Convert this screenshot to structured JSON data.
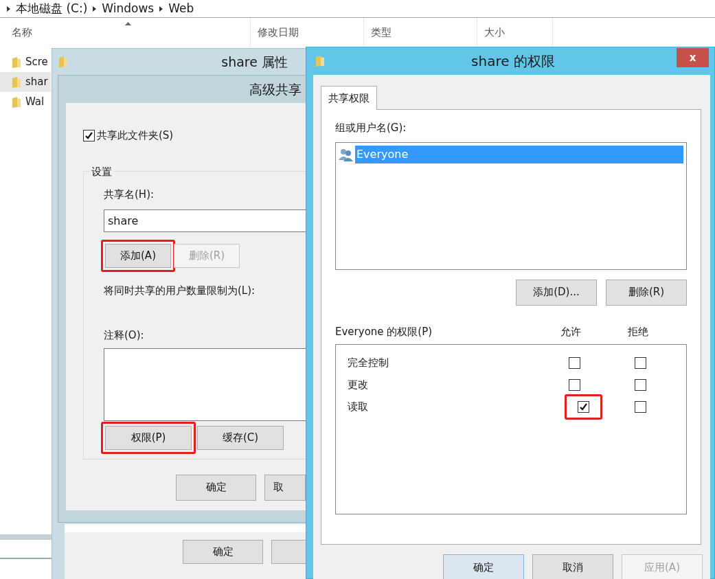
{
  "explorer": {
    "breadcrumb": [
      "本地磁盘 (C:)",
      "Windows",
      "Web"
    ],
    "columns": [
      "名称",
      "修改日期",
      "类型",
      "大小"
    ],
    "files": [
      {
        "name": "Scre",
        "selected": false
      },
      {
        "name": "shar",
        "selected": true
      },
      {
        "name": "Wal",
        "selected": false
      }
    ]
  },
  "properties_window": {
    "title": "share 属性",
    "buttons": [
      {
        "label": "确定"
      }
    ]
  },
  "advanced_sharing": {
    "title": "高级共享",
    "share_checkbox": {
      "label": "共享此文件夹(S)",
      "checked": true
    },
    "group_label": "设置",
    "share_name_label": "共享名(H):",
    "share_name_value": "share",
    "name_buttons": [
      {
        "label": "添加(A)",
        "disabled": false,
        "highlighted": true
      },
      {
        "label": "删除(R)",
        "disabled": true,
        "highlighted": false
      }
    ],
    "limit_label": "将同时共享的用户数量限制为(L):",
    "comment_label": "注释(O):",
    "lower_buttons": [
      {
        "label": "权限(P)",
        "disabled": false,
        "highlighted": true
      },
      {
        "label": "缓存(C)",
        "disabled": false,
        "highlighted": false
      }
    ],
    "footer_buttons": [
      {
        "label": "确定"
      },
      {
        "label": "取"
      }
    ]
  },
  "permissions_window": {
    "title": "share 的权限",
    "close": "x",
    "tabs": [
      {
        "label": "共享权限",
        "selected": true
      }
    ],
    "users_label": "组或用户名(G):",
    "users": [
      {
        "name": "Everyone",
        "selected": true
      }
    ],
    "user_buttons": [
      {
        "label": "添加(D)...",
        "disabled": false
      },
      {
        "label": "删除(R)",
        "disabled": false
      }
    ],
    "permissions_label": "Everyone 的权限(P)",
    "allow_header": "允许",
    "deny_header": "拒绝",
    "permissions": [
      {
        "name": "完全控制",
        "allow": false,
        "deny": false,
        "highlighted": false
      },
      {
        "name": "更改",
        "allow": false,
        "deny": false,
        "highlighted": false
      },
      {
        "name": "读取",
        "allow": true,
        "deny": false,
        "highlighted": true
      }
    ],
    "footer_buttons": [
      {
        "label": "确定",
        "disabled": false,
        "focused": true
      },
      {
        "label": "取消",
        "disabled": false,
        "focused": false
      },
      {
        "label": "应用(A)",
        "disabled": true,
        "focused": false
      }
    ]
  }
}
